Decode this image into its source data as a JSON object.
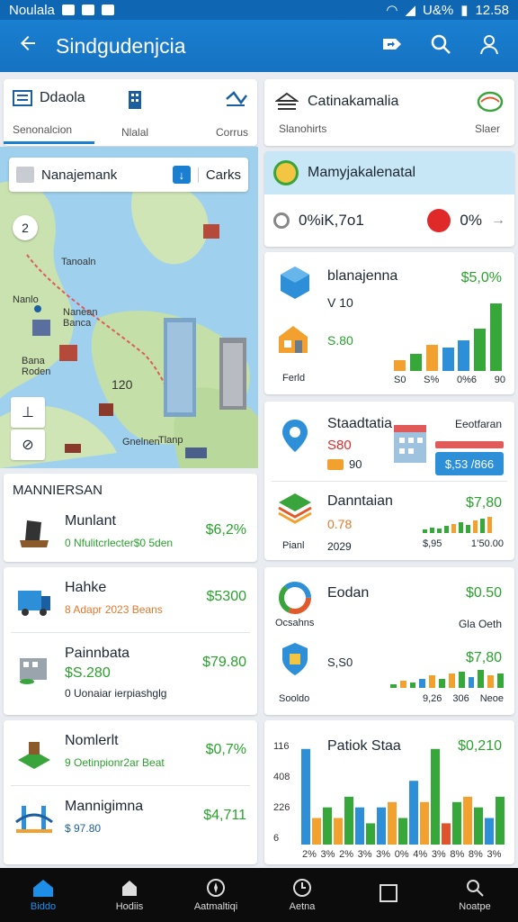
{
  "status": {
    "left_text": "Noulala",
    "right_text": "U&%",
    "time": "12.58"
  },
  "appbar": {
    "title": "Sindgudenjcia"
  },
  "tabs": [
    {
      "label": "Ddaola",
      "sub": "Senonalcion",
      "icon": "list-icon"
    },
    {
      "label": "",
      "sub": "Nlalal",
      "icon": "building-icon"
    },
    {
      "label": "",
      "sub": "Corrus",
      "icon": "route-icon"
    }
  ],
  "tab_right": {
    "label": "Catinakamalia",
    "sub_left": "Slanohirts",
    "sub_right": "Slaer"
  },
  "map": {
    "search_text": "Nanajemank",
    "search_action": "Carks",
    "pin_label": "2",
    "labels": [
      "Tanoaln",
      "Nanean\nBanca",
      "Nanlo",
      "Bana\nRoden",
      "Tlanp",
      "120",
      "Gnelnen"
    ]
  },
  "right_top": {
    "header": "Mamyjakalenatal",
    "value": "0%iK,7o1",
    "pct": "0%"
  },
  "right_card1": {
    "title": "blanajenna",
    "value": "$5,0%",
    "sub": "V 10",
    "amount": "S.80",
    "tag": "Ferld",
    "axis": [
      "S0",
      "S%",
      "0%6",
      "90"
    ],
    "bars": [
      {
        "v": 0.12,
        "c": "#f2a12e"
      },
      {
        "v": 0.18,
        "c": "#36a83a"
      },
      {
        "v": 0.28,
        "c": "#f2a12e"
      },
      {
        "v": 0.25,
        "c": "#2c8fd8"
      },
      {
        "v": 0.33,
        "c": "#2c8fd8"
      },
      {
        "v": 0.45,
        "c": "#36a83a"
      },
      {
        "v": 0.72,
        "c": "#36a83a"
      }
    ]
  },
  "right_card2": {
    "title": "Staadtatia",
    "right_label": "Eeotfaran",
    "amount": "S80",
    "sub": "90",
    "badge": "$,53 /866"
  },
  "right_card3": {
    "title": "Danntaian",
    "value": "$7,80",
    "sub": "0.78",
    "tag": "Pianl",
    "year": "2029",
    "axis": [
      "$,95",
      "1’50.00"
    ]
  },
  "right_card4": {
    "title": "Eodan",
    "value": "$0.50",
    "sub_left": "Ocsahns",
    "sub_right": "Gla Oeth",
    "amount": "S,S0",
    "value2": "$7,80",
    "tag": "Sooldo",
    "axis": [
      "9,26",
      "306",
      "Neoe"
    ]
  },
  "chart_data": {
    "type": "bar",
    "title": "Patiok Staa",
    "value_label": "$0,210",
    "ytick_labels": [
      "116",
      "408",
      "226",
      "6"
    ],
    "xtick_labels": [
      "2%",
      "3%",
      "2%",
      "3%",
      "3%",
      "0%",
      "4%",
      "3%",
      "8%",
      "8%",
      "3%"
    ],
    "values": [
      0.9,
      0.25,
      0.35,
      0.25,
      0.45,
      0.35,
      0.2,
      0.35,
      0.4,
      0.25,
      0.6,
      0.4,
      0.9,
      0.2,
      0.4,
      0.45,
      0.35,
      0.25,
      0.45
    ],
    "colors": [
      "#2c8fd8",
      "#f2a12e",
      "#36a83a",
      "#f2a12e",
      "#36a83a",
      "#2c8fd8",
      "#36a83a",
      "#2c8fd8",
      "#f2a12e",
      "#36a83a",
      "#2c8fd8",
      "#f2a12e",
      "#36a83a",
      "#e0532b",
      "#36a83a",
      "#f2a12e",
      "#36a83a",
      "#2c8fd8",
      "#36a83a"
    ]
  },
  "left_list": {
    "header": "MANNIERSAN",
    "items": [
      {
        "title": "Munlant",
        "sub": "0 Nfulitcrlecter$0 5den",
        "value": "$6,2%",
        "sub_color": "green"
      },
      {
        "title": "Hahke",
        "sub": "8 Adapr 2023 Beans",
        "value": "$5300",
        "sub_color": "orange"
      },
      {
        "title": "Painnbata",
        "sub": "0 Uonaiar ierpiashglg",
        "amount": "$S.280",
        "value": "$79.80",
        "sub_color": "dark"
      },
      {
        "title": "Nomlerlt",
        "sub": "9 Oetinpionr2ar Beat",
        "value": "$0,7%",
        "sub_color": "green"
      },
      {
        "title": "Mannigimna",
        "sub": "$ 97.80",
        "value": "$4,711",
        "sub_color": "blue"
      }
    ]
  },
  "bottom_nav": [
    {
      "label": "Biddo",
      "icon": "home-icon"
    },
    {
      "label": "Hodiis",
      "icon": "house-icon"
    },
    {
      "label": "Aatmaltiqi",
      "icon": "compass-icon"
    },
    {
      "label": "Aetna",
      "icon": "clock-icon"
    },
    {
      "label": "",
      "icon": "square-icon"
    },
    {
      "label": "Noatpe",
      "icon": "search-icon"
    }
  ]
}
